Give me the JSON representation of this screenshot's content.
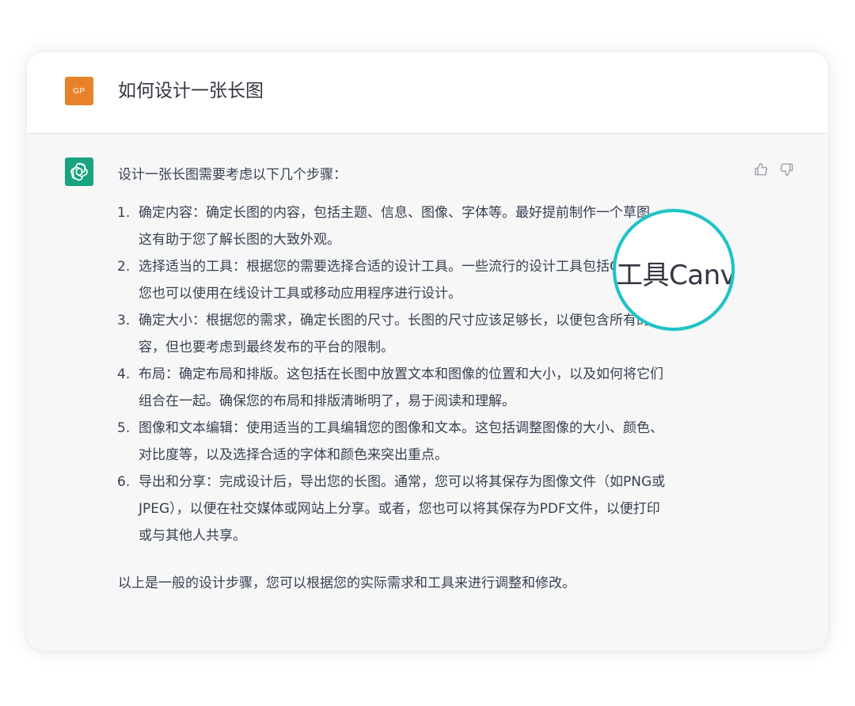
{
  "colors": {
    "user_avatar_bg": "#e8822a",
    "bot_avatar_bg": "#19a37f",
    "magnifier_ring": "#1ec2c6",
    "text": "#374151"
  },
  "user": {
    "avatar_text": "GP",
    "question": "如何设计一张长图"
  },
  "assistant": {
    "avatar_icon": "openai-logo-icon",
    "intro": "设计一张长图需要考虑以下几个步骤：",
    "steps": [
      {
        "num": "1.",
        "lines": [
          "确定内容：确定长图的内容，包括主题、信息、图像、字体等。最好提前制作一个草图，",
          "这有助于您了解长图的大致外观。"
        ]
      },
      {
        "num": "2.",
        "lines": [
          "选择适当的工具：根据您的需要选择合适的设计工具。一些流行的设计工具包括Canva，",
          "您也可以使用在线设计工具或移动应用程序进行设计。"
        ]
      },
      {
        "num": "3.",
        "lines": [
          "确定大小：根据您的需求，确定长图的尺寸。长图的尺寸应该足够长，以便包含所有的内",
          "容，但也要考虑到最终发布的平台的限制。"
        ]
      },
      {
        "num": "4.",
        "lines": [
          "布局：确定布局和排版。这包括在长图中放置文本和图像的位置和大小，以及如何将它们",
          "组合在一起。确保您的布局和排版清晰明了，易于阅读和理解。"
        ]
      },
      {
        "num": "5.",
        "lines": [
          "图像和文本编辑：使用适当的工具编辑您的图像和文本。这包括调整图像的大小、颜色、",
          "对比度等，以及选择合适的字体和颜色来突出重点。"
        ]
      },
      {
        "num": "6.",
        "lines": [
          "导出和分享：完成设计后，导出您的长图。通常，您可以将其保存为图像文件（如PNG或",
          "JPEG），以便在社交媒体或网站上分享。或者，您也可以将其保存为PDF文件，以便打印",
          "或与其他人共享。"
        ]
      }
    ],
    "outro": "以上是一般的设计步骤，您可以根据您的实际需求和工具来进行调整和修改。"
  },
  "feedback": {
    "thumbs_up_icon": "thumbs-up-icon",
    "thumbs_down_icon": "thumbs-down-icon"
  },
  "magnifier": {
    "text": "工具Canva"
  }
}
